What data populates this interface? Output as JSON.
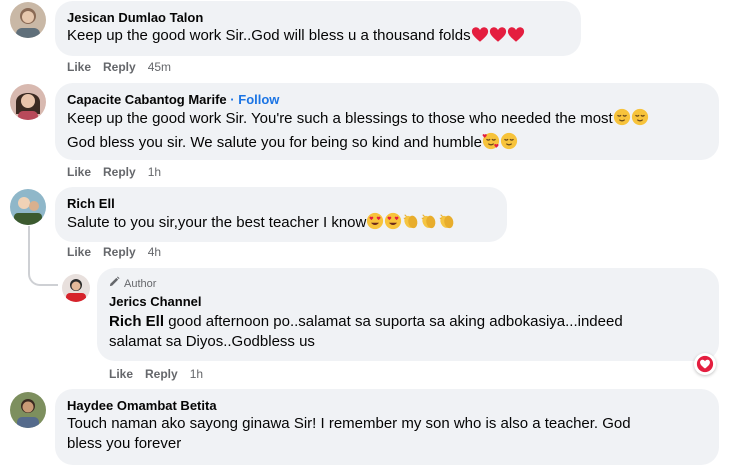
{
  "comments": [
    {
      "name": "Jesican Dumlao Talon",
      "lines": [
        "Keep up the good work Sir..God will bless u a thousand folds"
      ],
      "like": "Like",
      "reply": "Reply",
      "time": "45m"
    },
    {
      "name": "Capacite Cabantog Marife",
      "separator": "·",
      "follow": "Follow",
      "lines": [
        "Keep up the good work Sir. You're such a blessings to those who needed the most",
        "God bless you sir. We salute you for being so kind and humble"
      ],
      "like": "Like",
      "reply": "Reply",
      "time": "1h"
    },
    {
      "name": "Rich Ell",
      "lines": [
        "Salute to you sir,your the best teacher I know"
      ],
      "like": "Like",
      "reply": "Reply",
      "time": "4h"
    },
    {
      "badge": "Author",
      "name": "Jerics Channel",
      "mention": "Rich Ell",
      "lines": [
        "good afternoon po..salamat sa suporta sa aking adbokasiya...indeed",
        "salamat sa Diyos..Godbless us"
      ],
      "like": "Like",
      "reply": "Reply",
      "time": "1h"
    },
    {
      "name": "Haydee Omambat Betita",
      "lines": [
        "Touch naman ako sayong ginawa Sir! I remember my son who is also a teacher. God",
        "bless you forever"
      ]
    }
  ],
  "icons": {
    "heart": "red-heart-emoji",
    "relieved": "relieved-face-emoji",
    "smiling_hearts": "smiling-face-with-hearts-emoji",
    "heart_eyes": "heart-eyes-emoji",
    "clap": "clapping-hands-emoji",
    "pencil": "pencil-icon",
    "love_reaction": "love-reaction-icon"
  },
  "colors": {
    "bubble": "#f0f2f5",
    "link": "#1b74e4",
    "meta": "#65676b",
    "heart": "#e41e3f"
  }
}
